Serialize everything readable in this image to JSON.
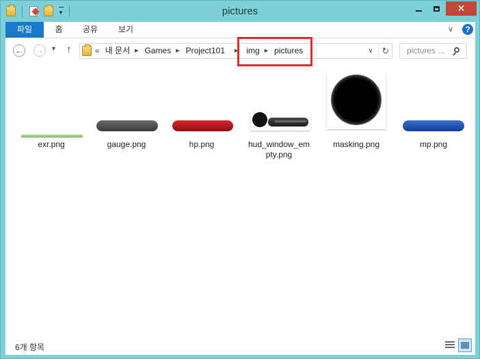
{
  "window": {
    "title": "pictures",
    "close_glyph": "✕"
  },
  "ribbon": {
    "tabs": [
      {
        "label": "파일"
      },
      {
        "label": "홈"
      },
      {
        "label": "공유"
      },
      {
        "label": "보기"
      }
    ],
    "help_glyph": "?",
    "chevron_glyph": "∨"
  },
  "navigation": {
    "back_glyph": "←",
    "forward_glyph": "→",
    "recent_glyph": "▼",
    "up_glyph": "↑",
    "path_lead": "«",
    "breadcrumb": [
      "내 문서",
      "Games",
      "Project101",
      "img",
      "pictures"
    ],
    "separator_glyph": "▶",
    "dropdown_glyph": "∨",
    "refresh_glyph": "↻"
  },
  "search": {
    "placeholder": "pictures ..."
  },
  "files": [
    {
      "name": "exr.png",
      "thumb": "thin-green-line"
    },
    {
      "name": "gauge.png",
      "thumb": "dark-gray-bar",
      "color": "#4a4a4a"
    },
    {
      "name": "hp.png",
      "thumb": "red-bar",
      "color": "#b0141a"
    },
    {
      "name": "hud_window_empty.png",
      "thumb": "hud-window"
    },
    {
      "name": "masking.png",
      "thumb": "black-blurred-circle"
    },
    {
      "name": "mp.png",
      "thumb": "blue-bar",
      "color": "#1b47a6"
    }
  ],
  "status": {
    "item_count": "6개 항목"
  },
  "colors": {
    "window_frame": "#7dd0d8",
    "file_tab": "#1979ca",
    "close_button": "#c7463c",
    "highlight": "#e3262e"
  }
}
